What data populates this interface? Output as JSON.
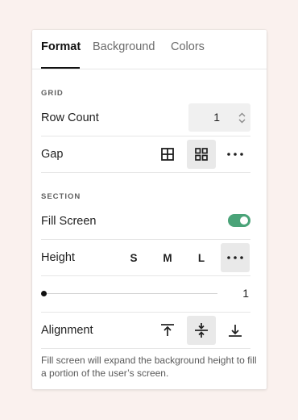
{
  "tabs": [
    {
      "label": "Format",
      "active": true
    },
    {
      "label": "Background",
      "active": false
    },
    {
      "label": "Colors",
      "active": false
    }
  ],
  "grid": {
    "heading": "GRID",
    "row_count_label": "Row Count",
    "row_count_value": "1",
    "gap_label": "Gap",
    "gap_options": [
      "grid-gap-icon",
      "grid-spaced-icon",
      "more-icon"
    ],
    "gap_selected": "grid-spaced-icon"
  },
  "section": {
    "heading": "SECTION",
    "fill_screen_label": "Fill Screen",
    "fill_screen_on": true,
    "height_label": "Height",
    "height_options": [
      "S",
      "M",
      "L"
    ],
    "height_selected": "more",
    "slider_value": "1",
    "alignment_label": "Alignment",
    "alignment_options": [
      "align-top-icon",
      "align-center-icon",
      "align-bottom-icon"
    ],
    "alignment_selected": "align-center-icon"
  },
  "help_text": "Fill screen will expand the background height to fill a portion of the user’s screen.",
  "colors": {
    "page_bg": "#faf1ee",
    "toggle_on": "#4aa378",
    "selected_bg": "#e9e9e9"
  }
}
